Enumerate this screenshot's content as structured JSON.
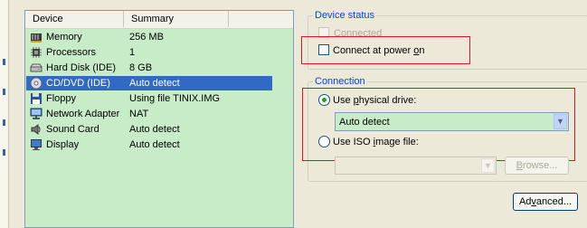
{
  "device_list": {
    "headers": {
      "device": "Device",
      "summary": "Summary"
    },
    "rows": [
      {
        "icon": "memory-icon",
        "device": "Memory",
        "summary": "256 MB"
      },
      {
        "icon": "processor-icon",
        "device": "Processors",
        "summary": "1"
      },
      {
        "icon": "hard-disk-icon",
        "device": "Hard Disk (IDE)",
        "summary": "8 GB"
      },
      {
        "icon": "cd-dvd-icon",
        "device": "CD/DVD (IDE)",
        "summary": "Auto detect"
      },
      {
        "icon": "floppy-icon",
        "device": "Floppy",
        "summary": "Using file TINIX.IMG"
      },
      {
        "icon": "network-adapter-icon",
        "device": "Network Adapter",
        "summary": "NAT"
      },
      {
        "icon": "sound-card-icon",
        "device": "Sound Card",
        "summary": "Auto detect"
      },
      {
        "icon": "display-icon",
        "device": "Display",
        "summary": "Auto detect"
      }
    ],
    "selected_device": "CD/DVD (IDE)"
  },
  "device_status": {
    "title": "Device status",
    "connected_label": "Connected",
    "connected_checked": false,
    "connected_enabled": false,
    "connect_power_pre": "Connect at power ",
    "connect_power_hot": "o",
    "connect_power_post": "n",
    "connect_power_checked": false
  },
  "connection": {
    "title": "Connection",
    "physical_pre": "Use ",
    "physical_hot": "p",
    "physical_post": "hysical drive:",
    "physical_selected": true,
    "drive_value": "Auto detect",
    "iso_pre": "Use ISO ",
    "iso_hot": "i",
    "iso_post": "mage file:",
    "iso_selected": false,
    "iso_value": "",
    "browse_hot": "B",
    "browse_post": "rowse...",
    "advanced_pre": "Ad",
    "advanced_hot": "v",
    "advanced_post": "anced..."
  },
  "colors": {
    "list_bg": "#c8ecc8",
    "selection": "#316ac5",
    "highlight_border": "#e0141e",
    "group_title": "#0046d5"
  }
}
